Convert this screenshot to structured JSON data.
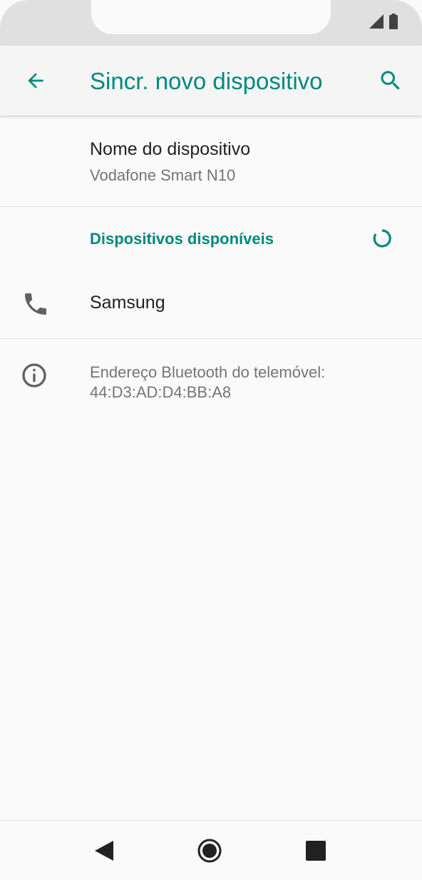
{
  "appbar": {
    "title": "Sincr. novo dispositivo",
    "back_icon": "arrow-back-icon",
    "search_icon": "search-icon"
  },
  "device_name": {
    "label": "Nome do dispositivo",
    "value": "Vodafone Smart N10"
  },
  "available": {
    "header": "Dispositivos disponíveis",
    "spinner_icon": "loading-spinner-icon",
    "devices": [
      {
        "name": "Samsung",
        "icon": "phone-icon"
      }
    ]
  },
  "info": {
    "icon": "info-icon",
    "text_line1": "Endereço Bluetooth do telemóvel:",
    "text_line2": "44:D3:AD:D4:BB:A8"
  },
  "colors": {
    "accent": "#00897b",
    "primary_text": "#212121",
    "secondary_text": "#757575",
    "background": "#fafafa"
  },
  "navbar": {
    "back_icon": "nav-back-icon",
    "home_icon": "nav-home-icon",
    "recents_icon": "nav-recents-icon"
  }
}
